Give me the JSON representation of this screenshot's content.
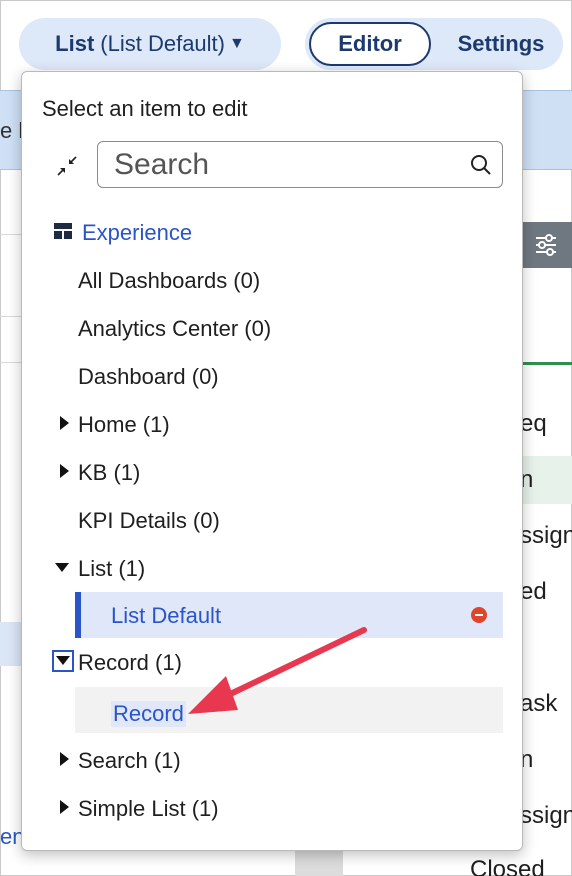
{
  "toolbar": {
    "view_bold": "List",
    "view_suffix": "(List Default)",
    "editor_label": "Editor",
    "settings_label": "Settings"
  },
  "background": {
    "band_text": "e h",
    "rows": [
      "eq",
      "n",
      "ssign",
      "ed",
      "ask",
      "n",
      "ssign",
      "Closed"
    ],
    "left_link": "en"
  },
  "popup": {
    "title": "Select an item to edit",
    "search_placeholder": "Search",
    "experience_label": "Experience",
    "items": [
      {
        "label": "All Dashboards (0)"
      },
      {
        "label": "Analytics Center (0)"
      },
      {
        "label": "Dashboard (0)"
      },
      {
        "label": "Home (1)"
      },
      {
        "label": "KB (1)"
      },
      {
        "label": "KPI Details (0)"
      },
      {
        "label": "List (1)"
      },
      {
        "label": "List Default"
      },
      {
        "label": "Record (1)"
      },
      {
        "label": "Record"
      },
      {
        "label": "Search (1)"
      },
      {
        "label": "Simple List (1)"
      }
    ]
  },
  "colors": {
    "accent": "#2a55c9",
    "annotation_arrow": "#e8384f",
    "remove_badge": "#e0452a"
  }
}
